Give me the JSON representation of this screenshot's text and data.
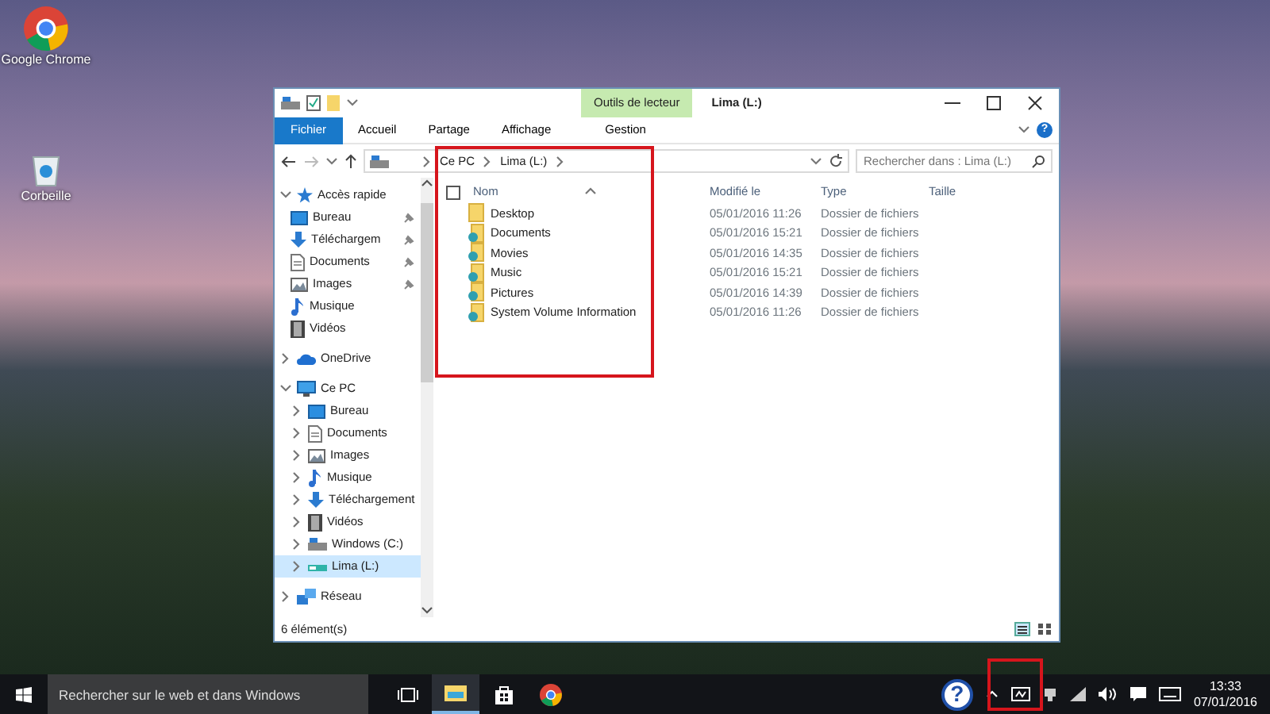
{
  "desktop_icons": [
    {
      "kind": "chrome",
      "label": "Google Chrome"
    },
    {
      "kind": "recycle",
      "label": "Corbeille"
    }
  ],
  "window": {
    "title": "Lima (L:)",
    "context_tab": "Outils de lecteur",
    "ribbon_tabs": [
      {
        "kind": "file",
        "label": "Fichier",
        "selected": false
      },
      {
        "kind": "tab",
        "label": "Accueil",
        "selected": false
      },
      {
        "kind": "tab",
        "label": "Partage",
        "selected": false
      },
      {
        "kind": "tab",
        "label": "Affichage",
        "selected": false
      },
      {
        "kind": "tab",
        "label": "Gestion",
        "selected": false
      }
    ],
    "select_all_checked": false,
    "help": "?",
    "breadcrumb": [
      "Ce PC",
      "Lima (L:)"
    ],
    "search": {
      "placeholder": "Rechercher dans : Lima (L:)"
    },
    "nav": [
      {
        "kind": "star",
        "label": "Accès rapide",
        "expanded": true,
        "selected": false,
        "children": [
          {
            "kind": "desktop",
            "label": "Bureau",
            "pinned": true,
            "selected": false
          },
          {
            "kind": "download",
            "label": "Téléchargem",
            "pinned": true,
            "selected": false
          },
          {
            "kind": "document",
            "label": "Documents",
            "pinned": true,
            "selected": false
          },
          {
            "kind": "image",
            "label": "Images",
            "pinned": true,
            "selected": false
          },
          {
            "kind": "music",
            "label": "Musique",
            "pinned": false,
            "selected": false
          },
          {
            "kind": "video",
            "label": "Vidéos",
            "pinned": false,
            "selected": false
          }
        ]
      },
      {
        "kind": "cloud",
        "label": "OneDrive",
        "expanded": false,
        "selected": false
      },
      {
        "kind": "pc",
        "label": "Ce PC",
        "expanded": true,
        "selected": false,
        "children": [
          {
            "kind": "desktop",
            "label": "Bureau",
            "expanded": false,
            "selected": false
          },
          {
            "kind": "document",
            "label": "Documents",
            "expanded": false,
            "selected": false
          },
          {
            "kind": "image",
            "label": "Images",
            "expanded": false,
            "selected": false
          },
          {
            "kind": "music",
            "label": "Musique",
            "expanded": false,
            "selected": false
          },
          {
            "kind": "download",
            "label": "Téléchargement",
            "expanded": false,
            "selected": false
          },
          {
            "kind": "video",
            "label": "Vidéos",
            "expanded": false,
            "selected": false
          },
          {
            "kind": "drive",
            "label": "Windows (C:)",
            "expanded": false,
            "selected": false
          },
          {
            "kind": "usb",
            "label": "Lima (L:)",
            "expanded": false,
            "selected": true
          }
        ]
      },
      {
        "kind": "network",
        "label": "Réseau",
        "expanded": false,
        "selected": false
      }
    ],
    "columns": [
      "Nom",
      "Modifié le",
      "Type",
      "Taille"
    ],
    "rows": [
      {
        "kind": "folder",
        "name": "Desktop",
        "modified": "05/01/2016 11:26",
        "type": "Dossier de fichiers"
      },
      {
        "kind": "shared",
        "name": "Documents",
        "modified": "05/01/2016 15:21",
        "type": "Dossier de fichiers"
      },
      {
        "kind": "shared",
        "name": "Movies",
        "modified": "05/01/2016 14:35",
        "type": "Dossier de fichiers"
      },
      {
        "kind": "shared",
        "name": "Music",
        "modified": "05/01/2016 15:21",
        "type": "Dossier de fichiers"
      },
      {
        "kind": "shared",
        "name": "Pictures",
        "modified": "05/01/2016 14:39",
        "type": "Dossier de fichiers"
      },
      {
        "kind": "shared",
        "name": "System Volume Information",
        "modified": "05/01/2016 11:26",
        "type": "Dossier de fichiers"
      }
    ],
    "status": "6 élément(s)"
  },
  "taskbar": {
    "search": {
      "placeholder": "Rechercher sur le web et dans Windows"
    },
    "apps": [
      {
        "kind": "taskview",
        "active": false
      },
      {
        "kind": "explorer",
        "active": true
      },
      {
        "kind": "store",
        "active": false
      },
      {
        "kind": "chrome",
        "active": false
      }
    ],
    "help": "?",
    "time": "13:33",
    "date": "07/01/2016"
  }
}
